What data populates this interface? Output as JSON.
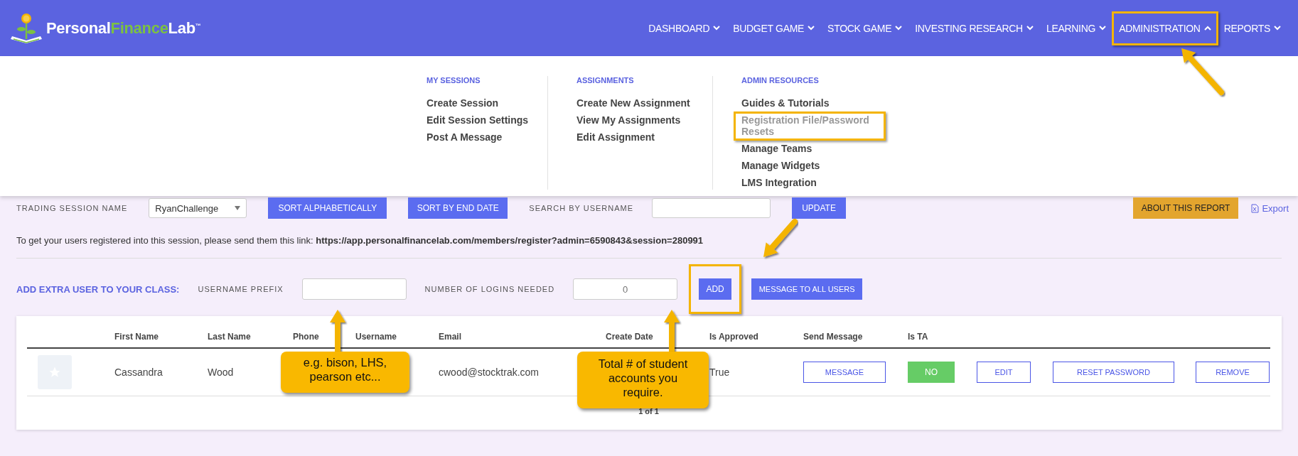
{
  "header": {
    "logo": {
      "part_1": "Personal",
      "part_2": "Finance",
      "part_3": "Lab",
      "trademark": "™"
    },
    "nav": [
      {
        "label": "DASHBOARD",
        "expanded": false
      },
      {
        "label": "BUDGET GAME",
        "expanded": false
      },
      {
        "label": "STOCK GAME",
        "expanded": false
      },
      {
        "label": "INVESTING RESEARCH",
        "expanded": false
      },
      {
        "label": "LEARNING",
        "expanded": false
      },
      {
        "label": "ADMINISTRATION",
        "expanded": true
      },
      {
        "label": "REPORTS",
        "expanded": false
      }
    ]
  },
  "dropdown": {
    "columns": [
      {
        "heading": "MY SESSIONS",
        "items": [
          {
            "label": "Create Session",
            "disabled": false
          },
          {
            "label": "Edit Session Settings",
            "disabled": false
          },
          {
            "label": "Post A Message",
            "disabled": false
          }
        ]
      },
      {
        "heading": "ASSIGNMENTS",
        "items": [
          {
            "label": "Create New Assignment",
            "disabled": false
          },
          {
            "label": "View My Assignments",
            "disabled": false
          },
          {
            "label": "Edit Assignment",
            "disabled": false
          }
        ]
      },
      {
        "heading": "ADMIN RESOURCES",
        "items": [
          {
            "label": "Guides & Tutorials",
            "disabled": false
          },
          {
            "label": "Registration File/Password Resets",
            "disabled": true
          },
          {
            "label": "Manage Teams",
            "disabled": false
          },
          {
            "label": "Manage Widgets",
            "disabled": false
          },
          {
            "label": "LMS Integration",
            "disabled": false
          }
        ]
      }
    ]
  },
  "filters": {
    "session_label": "TRADING SESSION NAME",
    "session_value": "RyanChallenge",
    "sort_buttons": [
      "SORT ALPHABETICALLY",
      "SORT BY END DATE"
    ],
    "search_label": "SEARCH BY USERNAME",
    "update": "UPDATE",
    "about": "ABOUT THIS REPORT",
    "export": "Export"
  },
  "register_note": "To get your users registered into this session, please send them this link: **https://app.personalfinancelab.com/members/register?admin=6590843&session=280991**",
  "add_user": {
    "title": "ADD EXTRA USER TO YOUR CLASS:",
    "prefix_label": "USERNAME PREFIX",
    "logins_label": "NUMBER OF LOGINS NEEDED",
    "logins_placeholder": "0",
    "add": "ADD",
    "message_all": "MESSAGE TO ALL USERS"
  },
  "table": {
    "columns": [
      "First Name",
      "Last Name",
      "Phone",
      "Username",
      "Email",
      "Create Date",
      "Is Approved",
      "Send Message",
      "Is TA"
    ],
    "rows": [
      {
        "first_name": "Cassandra",
        "last_name": "Wood",
        "email": "cwood@stocktrak.com",
        "is_approved": "True",
        "message": "MESSAGE",
        "is_ta": "NO",
        "edit": "EDIT",
        "reset": "RESET PASSWORD",
        "remove": "REMOVE"
      }
    ],
    "pagination": "1 of 1"
  },
  "annotations": {
    "callouts": [
      {
        "text": "e.g. bison, LHS, pearson etc..."
      },
      {
        "text": "Total # of student accounts you require."
      }
    ]
  }
}
